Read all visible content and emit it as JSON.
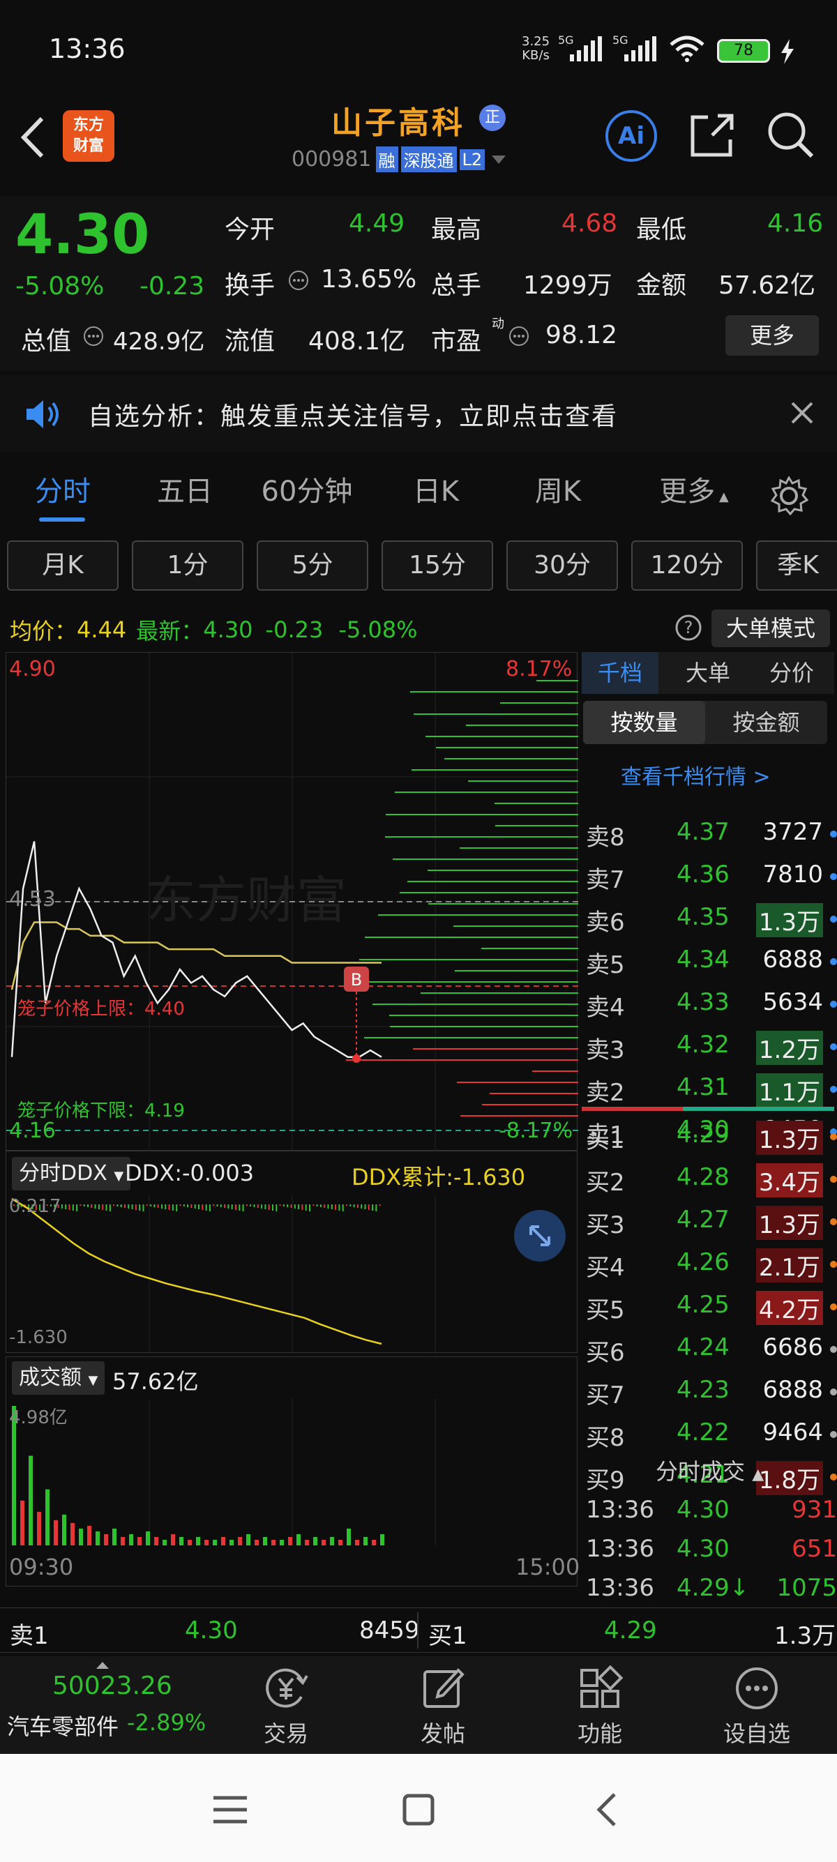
{
  "status_bar": {
    "time": "13:36",
    "net_speed_top": "3.25",
    "net_speed_bottom": "KB/s",
    "sig1": "5G",
    "sig2": "5G",
    "battery": "78"
  },
  "header": {
    "logo_top": "东方",
    "logo_bottom": "财富",
    "stock_name": "山子高科",
    "zheng_badge": "正",
    "stock_code": "000981",
    "tag_rong": "融",
    "tag_connect": "深股通",
    "tag_level": "L2",
    "ai_label": "Ai"
  },
  "quote": {
    "price": "4.30",
    "change_pct": "-5.08%",
    "change_abs": "-0.23",
    "open_label": "今开",
    "open": "4.49",
    "high_label": "最高",
    "high": "4.68",
    "low_label": "最低",
    "low": "4.16",
    "turnover_label": "换手",
    "turnover": "13.65%",
    "volume_label": "总手",
    "volume": "1299万",
    "amount_label": "金额",
    "amount": "57.62亿",
    "mktcap_label": "总值",
    "mktcap": "428.9亿",
    "float_label": "流值",
    "float": "408.1亿",
    "pe_label": "市盈",
    "pe_sup": "动",
    "pe": "98.12",
    "more_btn": "更多"
  },
  "notice": {
    "text": "自选分析：触发重点关注信号，立即点击查看"
  },
  "tabs": [
    "分时",
    "五日",
    "60分钟",
    "日K",
    "周K",
    "更多"
  ],
  "period_buttons": [
    "月K",
    "1分",
    "5分",
    "15分",
    "30分",
    "120分",
    "季K"
  ],
  "avg_line": {
    "avg_label": "均价：",
    "avg": "4.44",
    "last_label": "最新：",
    "last": "4.30",
    "chg": "-0.23",
    "pct": "-5.08%"
  },
  "big_order_btn": "大单模式",
  "chart": {
    "y_top": "4.90",
    "y_mid": "4.53",
    "y_bot": "4.16",
    "pct_top": "8.17%",
    "pct_bot": "-8.17%",
    "watermark": "东方财富",
    "upper_limit": "笼子价格上限：4.40",
    "lower_limit": "笼子价格下限：4.19",
    "marker": "B",
    "x_start": "09:30",
    "x_end": "15:00"
  },
  "chart_data": {
    "type": "line",
    "series": [
      {
        "values": [
          4.3,
          4.55,
          4.62,
          4.38,
          4.45,
          4.5,
          4.55,
          4.52,
          4.48,
          4.47,
          4.42,
          4.45,
          4.41,
          4.38,
          4.4,
          4.43,
          4.41,
          4.42,
          4.4,
          4.39,
          4.41,
          4.42,
          4.4,
          4.38,
          4.36,
          4.34,
          4.35,
          4.33,
          4.32,
          4.31,
          4.3,
          4.3,
          4.31,
          4.3
        ]
      },
      {
        "values": [
          4.4,
          4.47,
          4.5,
          4.5,
          4.5,
          4.49,
          4.49,
          4.48,
          4.48,
          4.48,
          4.47,
          4.47,
          4.47,
          4.47,
          4.46,
          4.46,
          4.46,
          4.46,
          4.46,
          4.45,
          4.45,
          4.45,
          4.45,
          4.45,
          4.45,
          4.44,
          4.44,
          4.44,
          4.44,
          4.44,
          4.44,
          4.44,
          4.44,
          4.44
        ]
      }
    ],
    "ylim": [
      4.16,
      4.9
    ]
  },
  "ddx": {
    "selector": "分时DDX",
    "value_label": "DDX:-0.003",
    "cum_label": "DDX累计:-1.630",
    "y_top": "0.217",
    "y_bot": "-1.630"
  },
  "ddx_data": [
    0.217,
    0.1,
    -0.05,
    -0.2,
    -0.35,
    -0.48,
    -0.58,
    -0.66,
    -0.74,
    -0.8,
    -0.86,
    -0.91,
    -0.96,
    -1.0,
    -1.05,
    -1.1,
    -1.15,
    -1.2,
    -1.25,
    -1.3,
    -1.38,
    -1.45,
    -1.52,
    -1.58,
    -1.63
  ],
  "volume": {
    "selector": "成交额",
    "value": "57.62亿",
    "y_top": "4.98亿"
  },
  "volume_data": [
    4.98,
    1.6,
    3.2,
    1.2,
    2.0,
    0.9,
    1.1,
    0.8,
    0.6,
    0.7,
    0.5,
    0.4,
    0.6,
    0.3,
    0.4,
    0.3,
    0.5,
    0.3,
    0.2,
    0.4,
    0.3,
    0.2,
    0.3,
    0.2,
    0.2,
    0.3,
    0.2,
    0.3,
    0.4,
    0.2,
    0.3,
    0.2,
    0.2,
    0.3,
    0.4,
    0.2,
    0.3,
    0.2,
    0.3,
    0.2,
    0.6,
    0.2,
    0.3,
    0.2,
    0.4
  ],
  "orderbook": {
    "tab_qian": "千档",
    "tab_big": "大单",
    "tab_price": "分价",
    "btn_qty": "按数量",
    "btn_amt": "按金额",
    "view_link": "查看千档行情 >",
    "sells": [
      {
        "label": "卖8",
        "price": "4.37",
        "vol": "3727"
      },
      {
        "label": "卖7",
        "price": "4.36",
        "vol": "7810"
      },
      {
        "label": "卖6",
        "price": "4.35",
        "vol": "1.3万"
      },
      {
        "label": "卖5",
        "price": "4.34",
        "vol": "6888"
      },
      {
        "label": "卖4",
        "price": "4.33",
        "vol": "5634"
      },
      {
        "label": "卖3",
        "price": "4.32",
        "vol": "1.2万"
      },
      {
        "label": "卖2",
        "price": "4.31",
        "vol": "1.1万"
      },
      {
        "label": "卖1",
        "price": "4.30",
        "vol": "8459"
      }
    ],
    "buys": [
      {
        "label": "买1",
        "price": "4.29",
        "vol": "1.3万"
      },
      {
        "label": "买2",
        "price": "4.28",
        "vol": "3.4万"
      },
      {
        "label": "买3",
        "price": "4.27",
        "vol": "1.3万"
      },
      {
        "label": "买4",
        "price": "4.26",
        "vol": "2.1万"
      },
      {
        "label": "买5",
        "price": "4.25",
        "vol": "4.2万"
      },
      {
        "label": "买6",
        "price": "4.24",
        "vol": "6686"
      },
      {
        "label": "买7",
        "price": "4.23",
        "vol": "6888"
      },
      {
        "label": "买8",
        "price": "4.22",
        "vol": "9464"
      },
      {
        "label": "买9",
        "price": "4.21",
        "vol": "1.8万"
      }
    ],
    "ticks_title": "分时成交",
    "ticks": [
      {
        "time": "13:36",
        "price": "4.30",
        "vol": "931"
      },
      {
        "time": "13:36",
        "price": "4.30",
        "vol": "651"
      },
      {
        "time": "13:36",
        "price": "4.29↓",
        "vol": "1075"
      }
    ]
  },
  "bottom_quote": {
    "sell_label": "卖1",
    "sell_price": "4.30",
    "sell_vol": "8459",
    "buy_label": "买1",
    "buy_price": "4.29",
    "buy_vol": "1.3万"
  },
  "nav": {
    "index_value": "50023.26",
    "index_name": "汽车零部件",
    "index_pct": "-2.89%",
    "trade": "交易",
    "post": "发帖",
    "func": "功能",
    "watch": "设自选"
  },
  "colors": {
    "up": "#e63535",
    "down": "#2ec22e",
    "accent": "#e8d21c",
    "blue": "#4a8cf0"
  }
}
